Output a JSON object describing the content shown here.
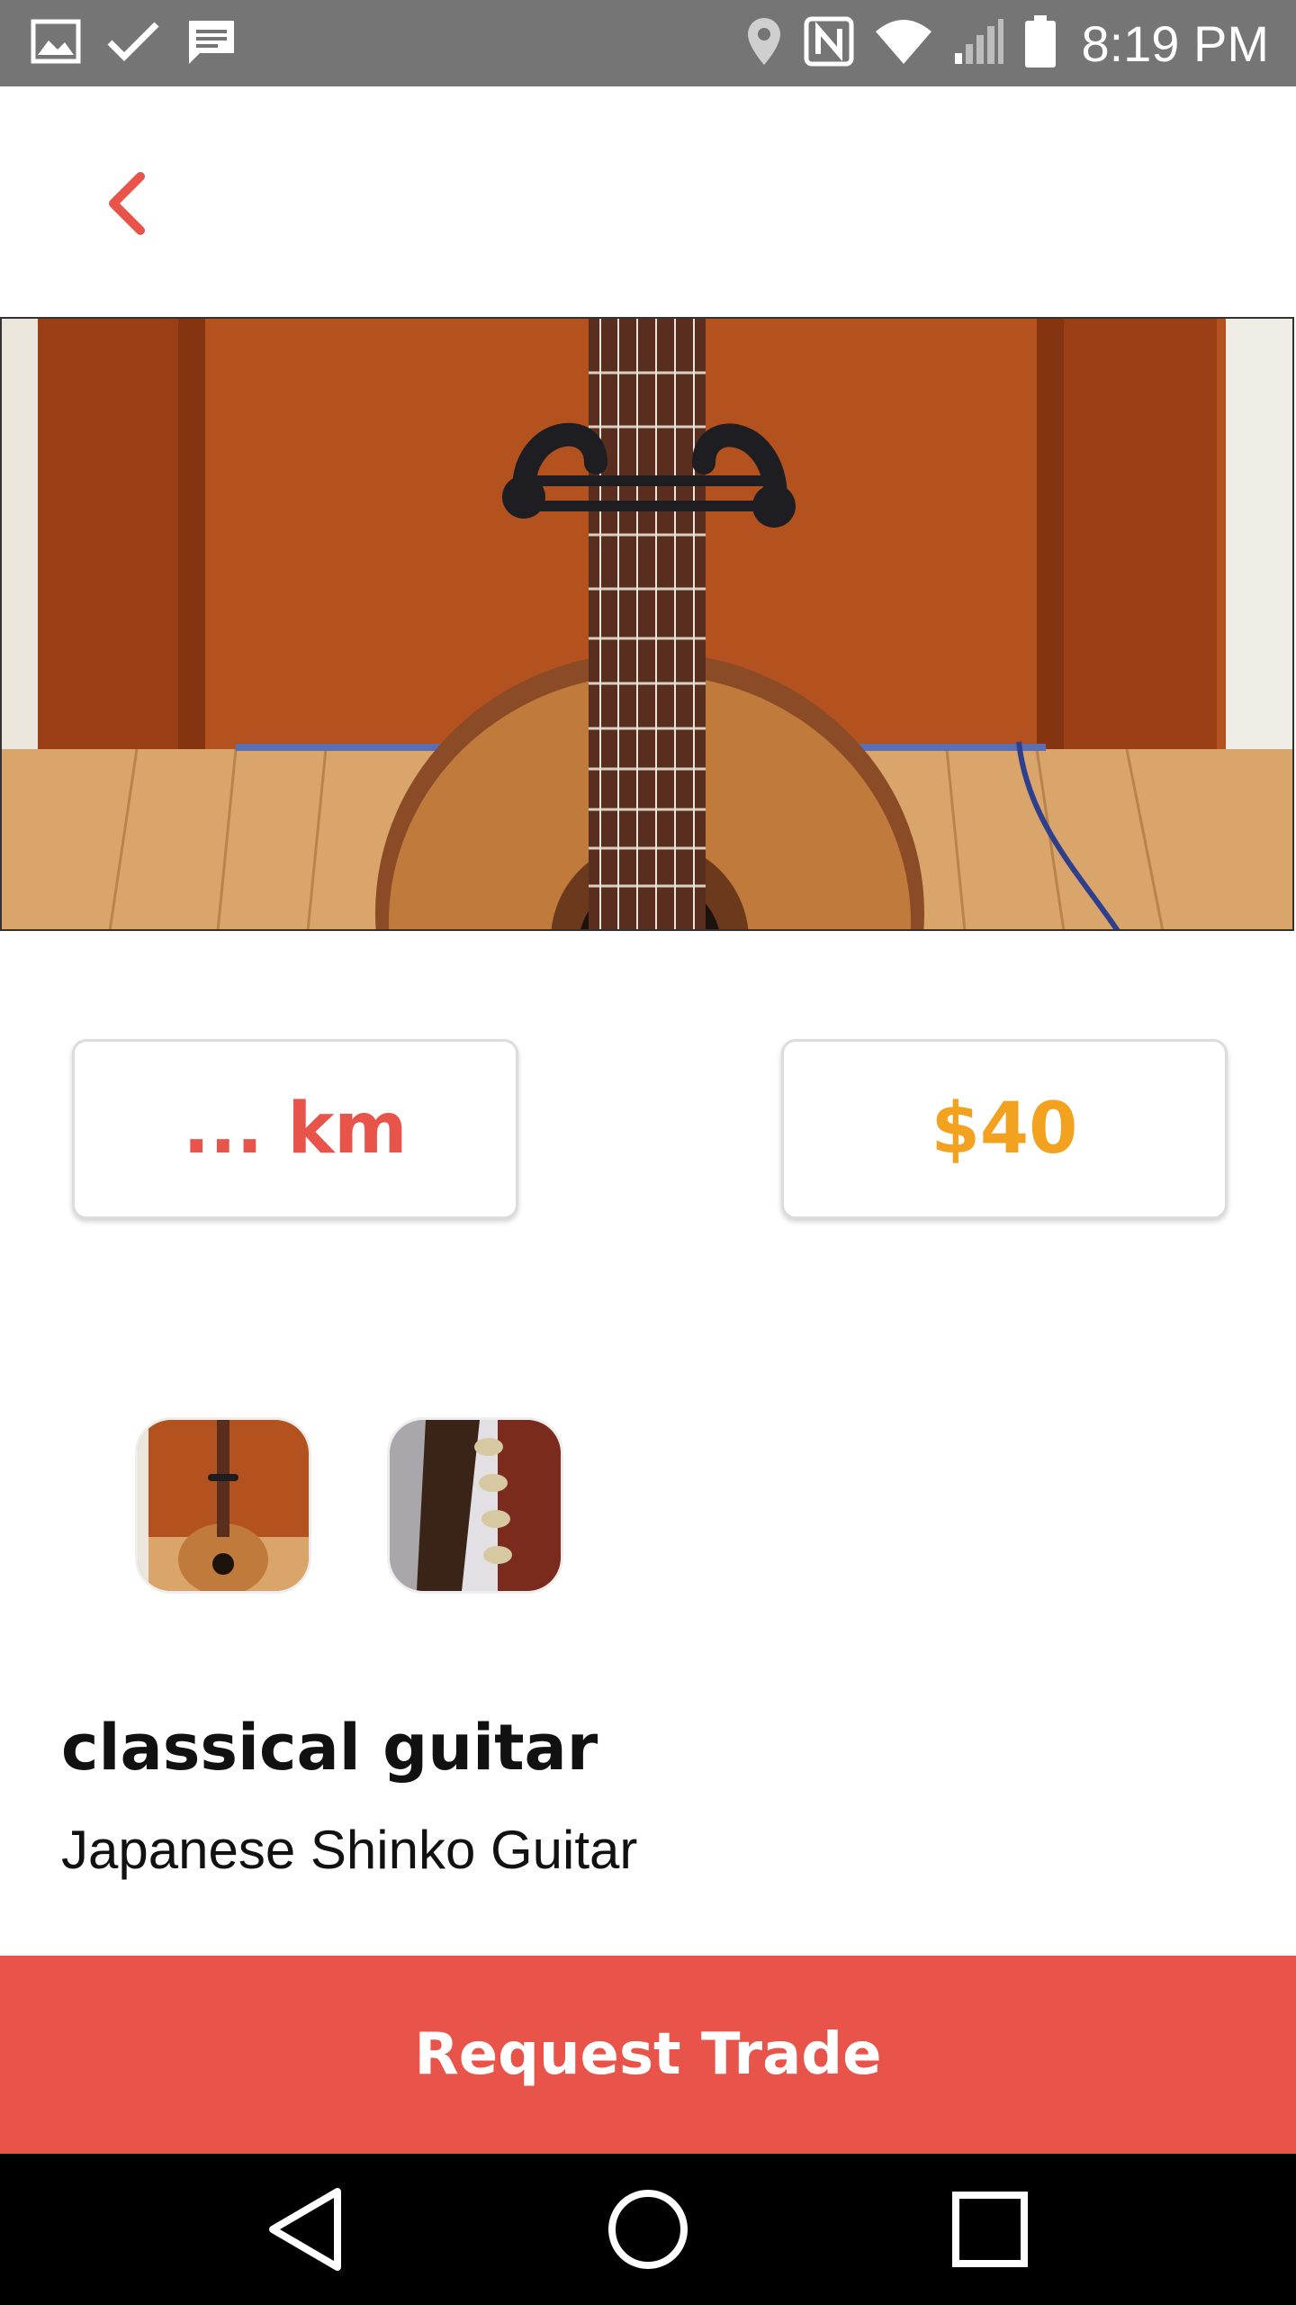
{
  "colors": {
    "accent": "#e8534a",
    "price": "#f2a21e",
    "button": "#e8534a"
  },
  "status_bar": {
    "time": "8:19 PM",
    "left_icons": [
      "image-icon",
      "check-icon",
      "message-icon"
    ],
    "right_icons": [
      "location-icon",
      "nfc-icon",
      "wifi-icon",
      "signal-icon",
      "battery-icon"
    ]
  },
  "item": {
    "distance": "... km",
    "price": "$40",
    "title": "classical guitar",
    "description": "Japanese Shinko Guitar",
    "thumbnails": [
      "guitar-front-photo",
      "guitar-headstock-photo"
    ]
  },
  "actions": {
    "request_trade": "Request Trade"
  },
  "nav": [
    "back-nav-icon",
    "home-nav-icon",
    "recents-nav-icon"
  ]
}
